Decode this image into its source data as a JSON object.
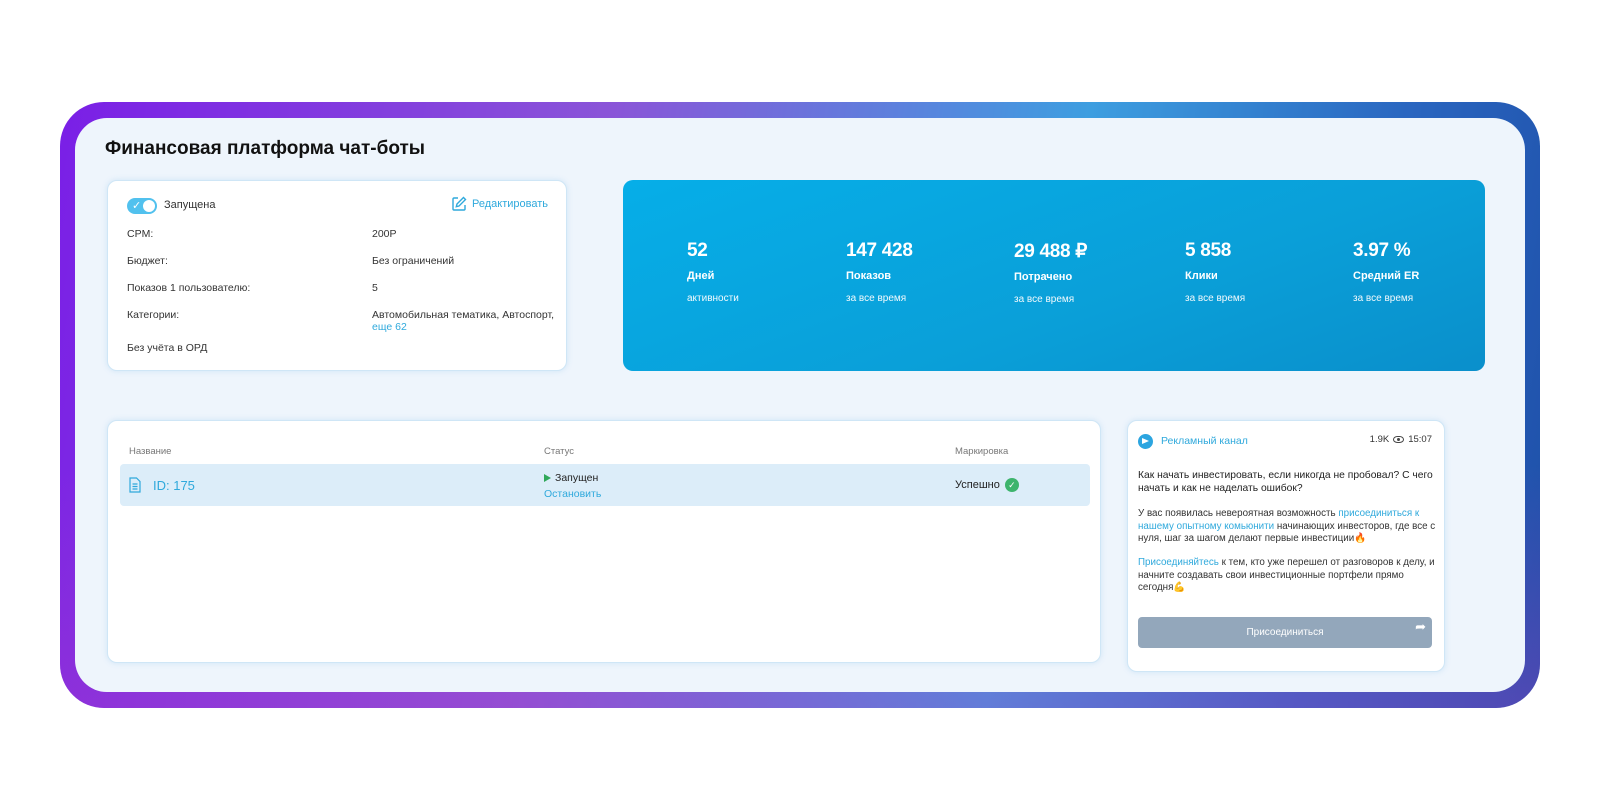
{
  "title": "Финансовая платформа чат-боты",
  "info": {
    "toggle_label": "Запущена",
    "edit_label": "Редактировать",
    "rows": [
      {
        "label": "CPM:",
        "value": "200Р"
      },
      {
        "label": "Бюджет:",
        "value": "Без ограничений"
      },
      {
        "label": "Показов 1 пользователю:",
        "value": "5"
      },
      {
        "label": "Категории:",
        "value": "Автомобильная тематика, Автоспорт,"
      }
    ],
    "categories_more": "еще 62",
    "ord_note": "Без учёта в ОРД"
  },
  "stats": [
    {
      "num": "52",
      "label": "Дней",
      "sub": "активности"
    },
    {
      "num": "147 428",
      "label": "Показов",
      "sub": "за все время"
    },
    {
      "num": "29 488 ₽",
      "label": "Потрачено",
      "sub": "за все время"
    },
    {
      "num": "5 858",
      "label": "Клики",
      "sub": "за все время"
    },
    {
      "num": "3.97 %",
      "label": "Средний ER",
      "sub": "за все время"
    }
  ],
  "table": {
    "headers": [
      "Название",
      "Статус",
      "Маркировка"
    ],
    "rows": [
      {
        "id": "ID: 175",
        "status": "Запущен",
        "action": "Остановить",
        "marking": "Успешно"
      }
    ]
  },
  "post": {
    "channel": "Рекламный канал",
    "views": "1.9K",
    "time": "15:07",
    "title": "Как начать инвестировать, если никогда не пробовал? С чего начать и как не наделать ошибок?",
    "p1_a": "У вас появилась невероятная возможность ",
    "p1_link": "присоединиться к нашему опытному комьюнити",
    "p1_b": " начинающих инвесторов, где все с нуля, шаг за шагом делают первые инвестиции🔥",
    "p2_link": "Присоединяйтесь",
    "p2_b": " к тем, кто уже перешел от разговоров к делу, и начните создавать свои инвестиционные портфели прямо сегодня💪",
    "button": "Присоединиться"
  }
}
